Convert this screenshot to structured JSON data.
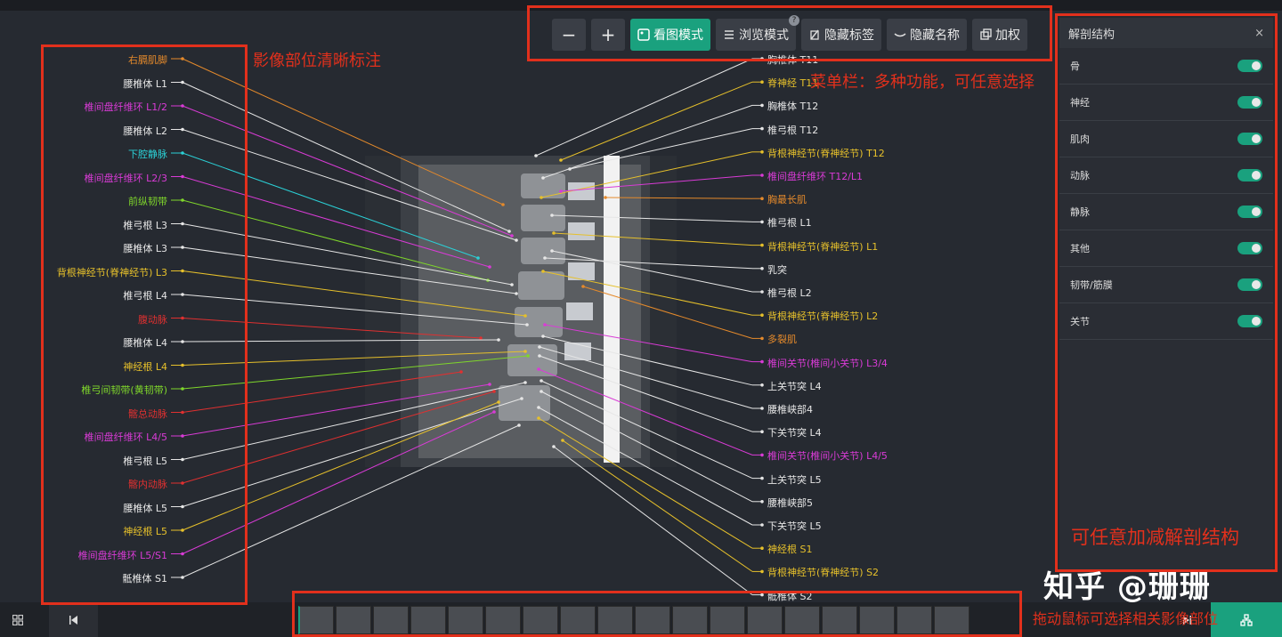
{
  "toolbar": {
    "zoom_out": "−",
    "zoom_in": "+",
    "view_mode": "看图模式",
    "browse_mode": "浏览模式",
    "help": "?",
    "hide_tags": "隐藏标签",
    "hide_names": "隐藏名称",
    "authorize": "加权"
  },
  "left_labels": [
    {
      "text": "右膈肌脚",
      "color": "#e58a2b"
    },
    {
      "text": "腰椎体 L1",
      "color": "#e6e6e6"
    },
    {
      "text": "椎间盘纤维环 L1/2",
      "color": "#d93bd6"
    },
    {
      "text": "腰椎体 L2",
      "color": "#e6e6e6"
    },
    {
      "text": "下腔静脉",
      "color": "#2bd0d6"
    },
    {
      "text": "椎间盘纤维环 L2/3",
      "color": "#d93bd6"
    },
    {
      "text": "前纵韧带",
      "color": "#7fd62b"
    },
    {
      "text": "椎弓根 L3",
      "color": "#e6e6e6"
    },
    {
      "text": "腰椎体 L3",
      "color": "#e6e6e6"
    },
    {
      "text": "背根神经节(脊神经节) L3",
      "color": "#e6c02b"
    },
    {
      "text": "椎弓根 L4",
      "color": "#e6e6e6"
    },
    {
      "text": "腹动脉",
      "color": "#e03030"
    },
    {
      "text": "腰椎体 L4",
      "color": "#e6e6e6"
    },
    {
      "text": "神经根 L4",
      "color": "#e6c02b"
    },
    {
      "text": "椎弓间韧带(黄韧带)",
      "color": "#7fd62b"
    },
    {
      "text": "髂总动脉",
      "color": "#e03030"
    },
    {
      "text": "椎间盘纤维环 L4/5",
      "color": "#d93bd6"
    },
    {
      "text": "椎弓根 L5",
      "color": "#e6e6e6"
    },
    {
      "text": "髂内动脉",
      "color": "#e03030"
    },
    {
      "text": "腰椎体 L5",
      "color": "#e6e6e6"
    },
    {
      "text": "神经根 L5",
      "color": "#e6c02b"
    },
    {
      "text": "椎间盘纤维环 L5/S1",
      "color": "#d93bd6"
    },
    {
      "text": "骶椎体 S1",
      "color": "#e6e6e6"
    }
  ],
  "right_labels": [
    {
      "text": "胸椎体 T11",
      "color": "#e6e6e6"
    },
    {
      "text": "脊神经 T11",
      "color": "#e6c02b"
    },
    {
      "text": "胸椎体 T12",
      "color": "#e6e6e6"
    },
    {
      "text": "椎弓根 T12",
      "color": "#e6e6e6"
    },
    {
      "text": "背根神经节(脊神经节) T12",
      "color": "#e6c02b"
    },
    {
      "text": "椎间盘纤维环 T12/L1",
      "color": "#d93bd6"
    },
    {
      "text": "胸最长肌",
      "color": "#e58a2b"
    },
    {
      "text": "椎弓根 L1",
      "color": "#e6e6e6"
    },
    {
      "text": "背根神经节(脊神经节) L1",
      "color": "#e6c02b"
    },
    {
      "text": "乳突",
      "color": "#e6e6e6"
    },
    {
      "text": "椎弓根 L2",
      "color": "#e6e6e6"
    },
    {
      "text": "背根神经节(脊神经节) L2",
      "color": "#e6c02b"
    },
    {
      "text": "多裂肌",
      "color": "#e58a2b"
    },
    {
      "text": "椎间关节(椎间小关节) L3/4",
      "color": "#d93bd6"
    },
    {
      "text": "上关节突 L4",
      "color": "#e6e6e6"
    },
    {
      "text": "腰椎峡部4",
      "color": "#e6e6e6"
    },
    {
      "text": "下关节突 L4",
      "color": "#e6e6e6"
    },
    {
      "text": "椎间关节(椎间小关节) L4/5",
      "color": "#d93bd6"
    },
    {
      "text": "上关节突 L5",
      "color": "#e6e6e6"
    },
    {
      "text": "腰椎峡部5",
      "color": "#e6e6e6"
    },
    {
      "text": "下关节突 L5",
      "color": "#e6e6e6"
    },
    {
      "text": "神经根 S1",
      "color": "#e6c02b"
    },
    {
      "text": "背根神经节(脊神经节) S2",
      "color": "#e6c02b"
    },
    {
      "text": "骶椎体 S2",
      "color": "#e6e6e6"
    }
  ],
  "panel": {
    "title": "解剖结构",
    "close": "×",
    "items": [
      {
        "label": "骨",
        "on": true
      },
      {
        "label": "神经",
        "on": true
      },
      {
        "label": "肌肉",
        "on": true
      },
      {
        "label": "动脉",
        "on": true
      },
      {
        "label": "静脉",
        "on": true
      },
      {
        "label": "其他",
        "on": true
      },
      {
        "label": "韧带/筋膜",
        "on": true
      },
      {
        "label": "关节",
        "on": true
      }
    ]
  },
  "annotations": {
    "left": "影像部位清晰标注",
    "toolbar": "菜单栏：多种功能，可任意选择",
    "panel": "可任意加减解剖结构",
    "thumbs": "拖动鼠标可选择相关影像部位"
  },
  "watermark": "知乎 @珊珊",
  "bottom": {
    "grid_icon": "grid-icon",
    "prev_icon": "prev-icon"
  },
  "colors": {
    "accent": "#1aa17e",
    "annotation": "#e2301c"
  }
}
